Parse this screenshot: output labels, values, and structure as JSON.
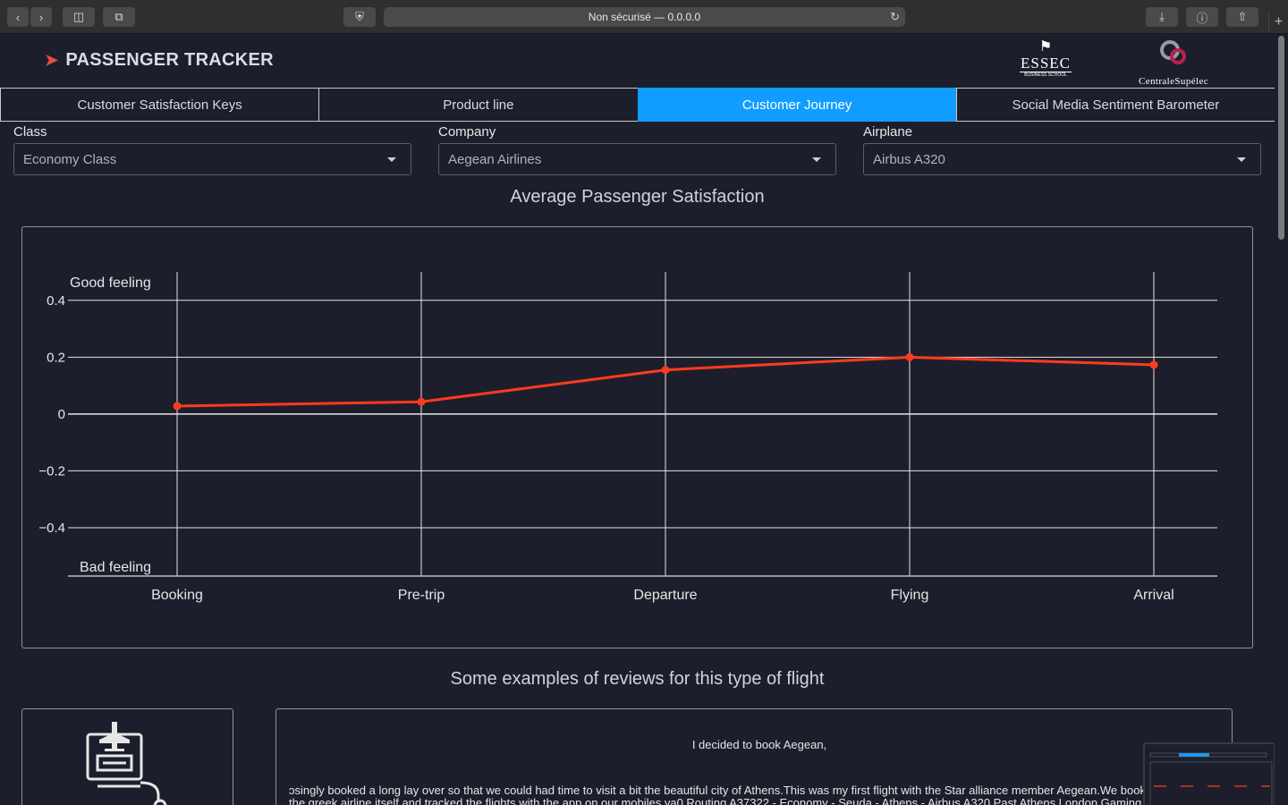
{
  "browser": {
    "url_text": "Non sécurisé — 0.0.0.0"
  },
  "app": {
    "title": "PASSENGER TRACKER",
    "logos": {
      "essec_name": "ESSEC",
      "essec_sub": "BUSINESS SCHOOL",
      "centrale_name": "CentraleSupélec"
    }
  },
  "tabs": [
    {
      "label": "Customer Satisfaction Keys",
      "active": false
    },
    {
      "label": "Product line",
      "active": false
    },
    {
      "label": "Customer Journey",
      "active": true
    },
    {
      "label": "Social Media Sentiment Barometer",
      "active": false
    }
  ],
  "filters": {
    "class": {
      "label": "Class",
      "value": "Economy Class"
    },
    "company": {
      "label": "Company",
      "value": "Aegean Airlines"
    },
    "airplane": {
      "label": "Airplane",
      "value": "Airbus A320"
    }
  },
  "chart_title": "Average Passenger Satisfaction",
  "chart_data": {
    "type": "line",
    "categories": [
      "Booking",
      "Pre-trip",
      "Departure",
      "Flying",
      "Arrival"
    ],
    "values": [
      0.028,
      0.043,
      0.155,
      0.2,
      0.173
    ],
    "ylim": [
      -0.57,
      0.5
    ],
    "yticks": [
      0.4,
      0.2,
      0,
      -0.2,
      -0.4
    ],
    "ytick_labels": [
      "0.4",
      "0.2",
      "0",
      "−0.2",
      "−0.4"
    ],
    "annotations": {
      "top": "Good feeling",
      "bottom": "Bad feeling"
    },
    "line_color": "#ff3b1f",
    "grid": true
  },
  "reviews": {
    "title": "Some examples of reviews for this type of flight",
    "head": "I decided to book Aegean,",
    "body_line1": "ɔsingly booked a long lay over so that we could had time to visit a bit the beautiful city of Athens.This was my first flight with the Star alliance member Aegean.We booked our economy",
    "body_line2": "the greek airline itself and tracked the flights with the app on our mobiles.ya0 Routing A37322 - Economy - Seuda - Athens - Airbus A320 Past Athens London Gaming soon Soon afte"
  }
}
